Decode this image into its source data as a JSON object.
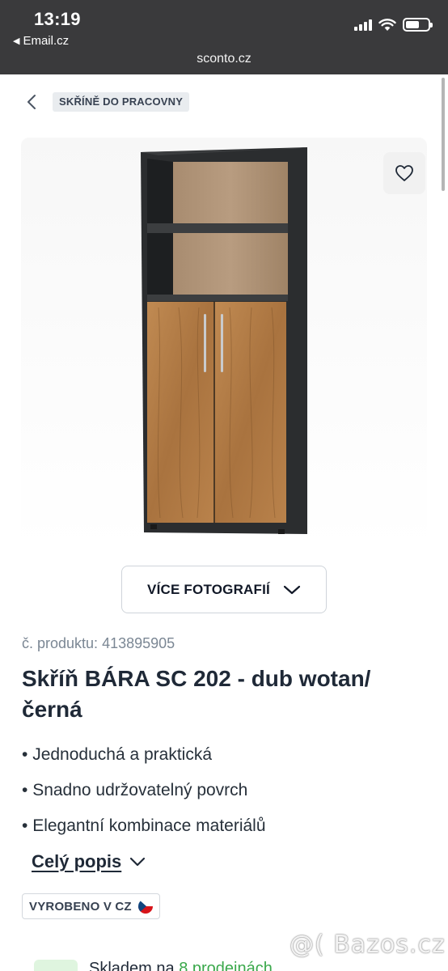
{
  "status_bar": {
    "time": "13:19",
    "back_app": "Email.cz",
    "url": "sconto.cz"
  },
  "breadcrumb": {
    "category": "SKŘÍNĚ DO PRACOVNY"
  },
  "gallery": {
    "more_photos_label": "VÍCE FOTOGRAFIÍ"
  },
  "product": {
    "number_label": "č. produktu:",
    "number_value": "413895905",
    "title": "Skříň BÁRA SC 202 - dub wotan/ černá",
    "features": [
      "Jednoduchá a praktická",
      "Snadno udržovatelný povrch",
      "Elegantní kombinace materiálů"
    ],
    "full_description_label": "Celý popis",
    "made_in_label": "VYROBENO V CZ",
    "stock_prefix": "Skladem na",
    "stock_link": "8 prodejnách"
  },
  "watermark": "@( Bazos.cz",
  "colors": {
    "status_bar_bg": "#3a3a3c",
    "stock_green": "#3aa84b",
    "wood": "#b07a45",
    "carcass": "#2b2d2f"
  }
}
